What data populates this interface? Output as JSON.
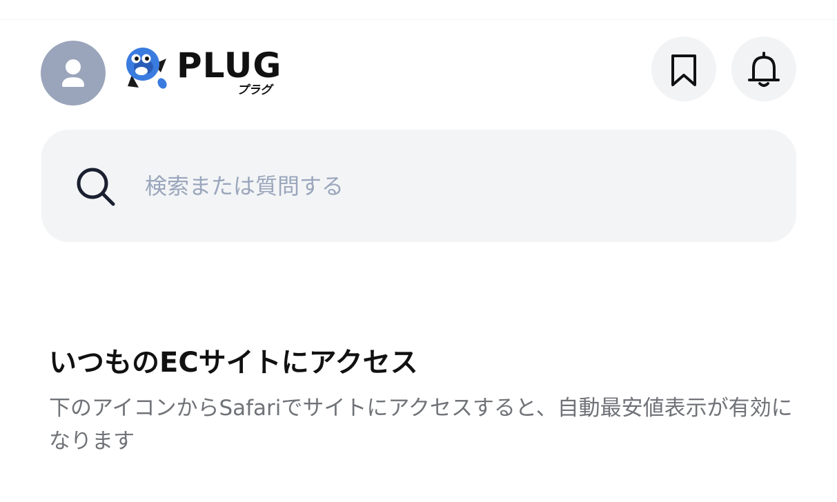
{
  "header": {
    "logo_text": "PLUG",
    "logo_kana": "プラグ",
    "icons": {
      "avatar": "user-icon",
      "bookmark": "bookmark-icon",
      "notifications": "bell-icon"
    }
  },
  "search": {
    "placeholder": "検索または質問する",
    "value": ""
  },
  "section": {
    "title": "いつものECサイトにアクセス",
    "description": "下のアイコンからSafariでサイトにアクセスすると、自動最安値表示が有効になります"
  },
  "colors": {
    "avatar_bg": "#9aa5bb",
    "icon_button_bg": "#f2f3f5",
    "search_bg": "#f3f4f6",
    "placeholder": "#9aa6bc",
    "title": "#111111",
    "description": "#6f7277",
    "logo_blue": "#3a7be0"
  }
}
